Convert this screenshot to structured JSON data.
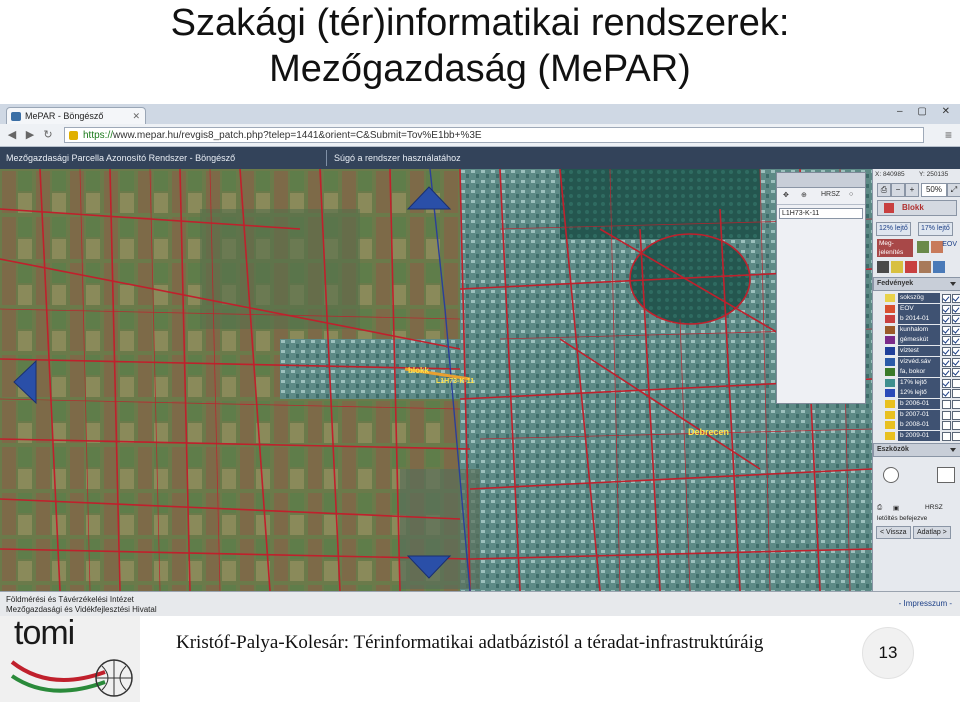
{
  "slide": {
    "title_line1": "Szakági (tér)informatikai rendszerek:",
    "title_line2": "Mezőgazdaság (MePAR)",
    "footer_text": "Kristóf-Palya-Kolesár: Térinformatikai adatbázistól a téradat-infrastruktúráig",
    "page_number": "13",
    "logo_text": "tomi"
  },
  "browser": {
    "tab_title": "MePAR - Böngésző",
    "address_scheme": "https://",
    "address_rest": "www.mepar.hu/revgis8_patch.php?telep=1441&orient=C&Submit=Tov%E1bb+%3E"
  },
  "app": {
    "header_left": "Mezőgazdasági Parcella Azonosító Rendszer - Böngésző",
    "header_right": "Súgó a rendszer használatához",
    "footer_line1": "Földmérési és Távérzékelési Intézet",
    "footer_line2": "Mezőgazdasági és Vidékfejlesztési Hivatal",
    "impressum": "- Impresszum -"
  },
  "map": {
    "labels": {
      "blokk": "blokk",
      "block_id": "L1H73-K-11",
      "city": "Debrecen"
    }
  },
  "search_panel": {
    "hrsz_label": "HRSZ",
    "result": "L1H73-K-11"
  },
  "sidebar": {
    "coord_x": "X: 840985",
    "coord_y": "Y: 250135",
    "zoom": "50%",
    "blokk_button": "Blokk",
    "lejto_12": "12% lejtő",
    "lejto_17": "17% lejtő",
    "megjelenites": "Meg-\njelenítés",
    "eov": "EOV",
    "fedvenyek": "Fedvények",
    "layers": [
      {
        "label": "sokszög",
        "color": "#e8d24a"
      },
      {
        "label": "EOV",
        "color": "#d85030"
      },
      {
        "label": "b 2014-01",
        "color": "#c84040"
      },
      {
        "label": "kunhalom",
        "color": "#9a5a2a"
      },
      {
        "label": "gémeskút",
        "color": "#7a2a8a"
      },
      {
        "label": "víztest",
        "color": "#1f3f9a"
      },
      {
        "label": "vízvéd.sáv",
        "color": "#2a5aa8"
      },
      {
        "label": "fa, bokor",
        "color": "#3a7a2a"
      },
      {
        "label": "17% lejtő",
        "color": "#3f8f8f"
      },
      {
        "label": "12% lejtő",
        "color": "#2a4ab8"
      },
      {
        "label": "b 2006-01",
        "color": "#e8c020"
      },
      {
        "label": "b 2007-01",
        "color": "#e8c020"
      },
      {
        "label": "b 2008-01",
        "color": "#e8c020"
      },
      {
        "label": "b 2009-01",
        "color": "#e8c020"
      }
    ],
    "eszkozok": "Eszközök",
    "hrsz_small": "HRSZ",
    "letoltes": "letöltés befejezve",
    "vissza": "< Vissza",
    "adatlap": "Adatlap >"
  }
}
